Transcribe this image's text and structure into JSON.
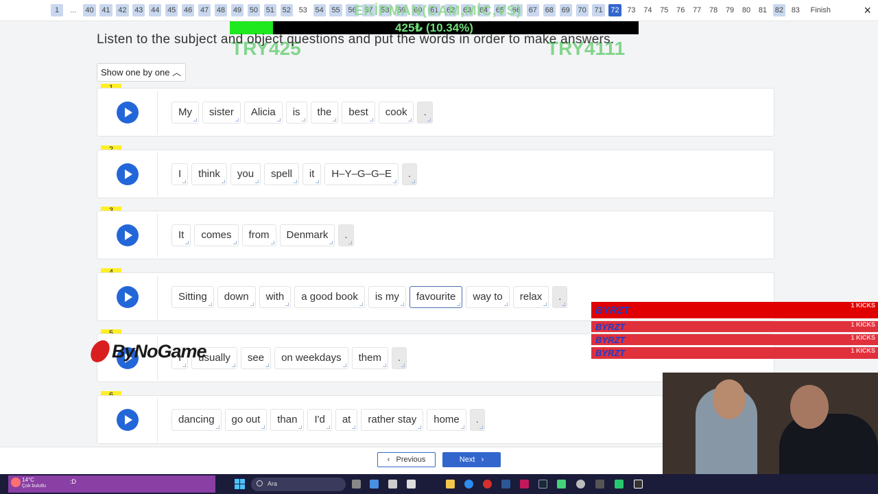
{
  "pagination": {
    "pages": [
      {
        "label": "1",
        "state": "done"
      },
      {
        "label": "...",
        "state": "dots"
      },
      {
        "label": "40",
        "state": "done"
      },
      {
        "label": "41",
        "state": "done"
      },
      {
        "label": "42",
        "state": "done"
      },
      {
        "label": "43",
        "state": "done"
      },
      {
        "label": "44",
        "state": "done"
      },
      {
        "label": "45",
        "state": "done"
      },
      {
        "label": "46",
        "state": "done"
      },
      {
        "label": "47",
        "state": "done"
      },
      {
        "label": "48",
        "state": "done"
      },
      {
        "label": "49",
        "state": "done"
      },
      {
        "label": "50",
        "state": "done"
      },
      {
        "label": "51",
        "state": "done"
      },
      {
        "label": "52",
        "state": "done"
      },
      {
        "label": "53",
        "state": "plain"
      },
      {
        "label": "54",
        "state": "done"
      },
      {
        "label": "55",
        "state": "done"
      },
      {
        "label": "56",
        "state": "done"
      },
      {
        "label": "57",
        "state": "done"
      },
      {
        "label": "58",
        "state": "done"
      },
      {
        "label": "59",
        "state": "done"
      },
      {
        "label": "60",
        "state": "done"
      },
      {
        "label": "61",
        "state": "done"
      },
      {
        "label": "62",
        "state": "done"
      },
      {
        "label": "63",
        "state": "done"
      },
      {
        "label": "64",
        "state": "done"
      },
      {
        "label": "65",
        "state": "done"
      },
      {
        "label": "66",
        "state": "done"
      },
      {
        "label": "67",
        "state": "done"
      },
      {
        "label": "68",
        "state": "done"
      },
      {
        "label": "69",
        "state": "done"
      },
      {
        "label": "70",
        "state": "done"
      },
      {
        "label": "71",
        "state": "done"
      },
      {
        "label": "72",
        "state": "current"
      },
      {
        "label": "73",
        "state": "plain"
      },
      {
        "label": "74",
        "state": "plain"
      },
      {
        "label": "75",
        "state": "plain"
      },
      {
        "label": "76",
        "state": "plain"
      },
      {
        "label": "77",
        "state": "plain"
      },
      {
        "label": "78",
        "state": "plain"
      },
      {
        "label": "79",
        "state": "plain"
      },
      {
        "label": "80",
        "state": "plain"
      },
      {
        "label": "81",
        "state": "plain"
      },
      {
        "label": "82",
        "state": "done"
      },
      {
        "label": "83",
        "state": "plain"
      }
    ],
    "finish_label": "Finish",
    "close_icon": "×"
  },
  "overlay": {
    "goal_title": "EKİPMAN(CAM,MİC,VS)",
    "goal_text": "425₺ (10.34%)",
    "goal_progress": 0.1034,
    "goal_min": "TRY425",
    "goal_max": "TRY4111",
    "logo_text": "ByNoGame",
    "kicks": [
      {
        "name": "BYRZT",
        "count": "1 KICKS"
      },
      {
        "name": "BYRZT",
        "count": "1 KICKS"
      },
      {
        "name": "BYRZT",
        "count": "1 KICKS"
      },
      {
        "name": "BYRZT",
        "count": "1 KICKS"
      }
    ]
  },
  "instruction": "Listen to the subject and object questions and put the words in order to make answers.",
  "show_mode": "Show one by one ︿",
  "questions": [
    {
      "number": "1",
      "words": [
        "My",
        "sister",
        "Alicia",
        "is",
        "the",
        "best",
        "cook",
        "."
      ]
    },
    {
      "number": "2",
      "words": [
        "I",
        "think",
        "you",
        "spell",
        "it",
        "H–Y–G–G–E",
        "."
      ]
    },
    {
      "number": "3",
      "words": [
        "It",
        "comes",
        "from",
        "Denmark",
        "."
      ]
    },
    {
      "number": "4",
      "words": [
        "Sitting",
        "down",
        "with",
        "a good book",
        "is my",
        "favourite",
        "way to",
        "relax",
        "."
      ],
      "selected_index": 5
    },
    {
      "number": "5",
      "words": [
        "I",
        "usually",
        "see",
        "on weekdays",
        "them",
        "."
      ]
    },
    {
      "number": "6",
      "words": [
        "dancing",
        "go out",
        "than",
        "I'd",
        "at",
        "rather stay",
        "home",
        "."
      ]
    }
  ],
  "nav": {
    "previous": "Previous",
    "next": "Next",
    "prev_icon": "‹",
    "next_icon": "›"
  },
  "taskbar": {
    "weather_temp": "14°C",
    "weather_desc": "Çok bulutlu",
    "weather_extra": ":D",
    "search_placeholder": "Ara"
  },
  "colors": {
    "accent": "#3366cc",
    "play": "#2366d8",
    "question_badge": "#ffef26",
    "page_done": "#c9d8ef"
  }
}
